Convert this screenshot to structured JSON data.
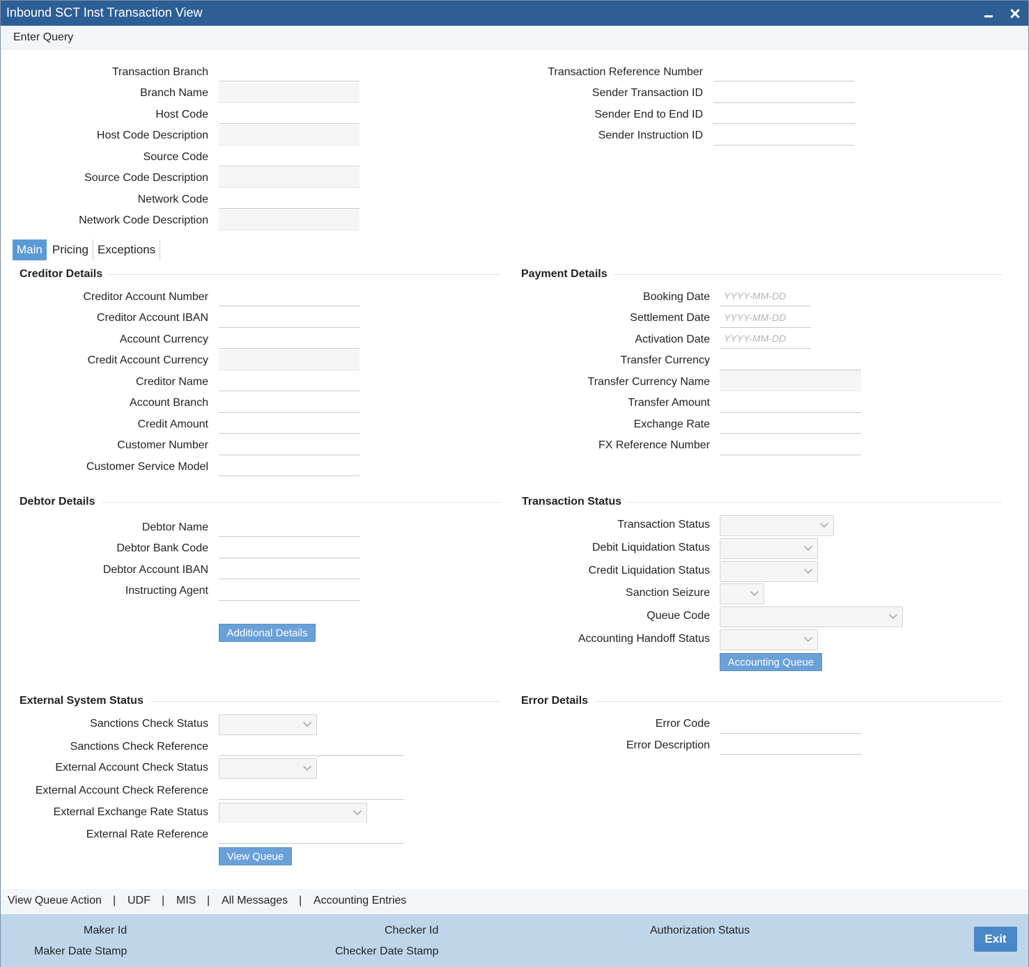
{
  "window": {
    "title": "Inbound SCT Inst Transaction View",
    "minimize_icon": "minimize-icon",
    "close_icon": "close-icon"
  },
  "toolbar": {
    "enter_query": "Enter Query"
  },
  "header": {
    "left": [
      {
        "label": "Transaction Branch",
        "value": ""
      },
      {
        "label": "Branch Name",
        "value": ""
      },
      {
        "label": "Host Code",
        "value": ""
      },
      {
        "label": "Host Code Description",
        "value": ""
      },
      {
        "label": "Source Code",
        "value": ""
      },
      {
        "label": "Source Code Description",
        "value": ""
      },
      {
        "label": "Network Code",
        "value": ""
      },
      {
        "label": "Network Code Description",
        "value": ""
      }
    ],
    "right": [
      {
        "label": "Transaction Reference Number",
        "value": ""
      },
      {
        "label": "Sender Transaction ID",
        "value": ""
      },
      {
        "label": "Sender End to End ID",
        "value": ""
      },
      {
        "label": "Sender Instruction ID",
        "value": ""
      }
    ]
  },
  "tabs": [
    {
      "label": "Main",
      "active": true
    },
    {
      "label": "Pricing",
      "active": false
    },
    {
      "label": "Exceptions",
      "active": false
    }
  ],
  "creditor": {
    "title": "Creditor Details",
    "fields": [
      {
        "label": "Creditor Account Number",
        "value": ""
      },
      {
        "label": "Creditor Account IBAN",
        "value": ""
      },
      {
        "label": "Account Currency",
        "value": ""
      },
      {
        "label": "Credit Account Currency",
        "value": ""
      },
      {
        "label": "Creditor Name",
        "value": ""
      },
      {
        "label": "Account Branch",
        "value": ""
      },
      {
        "label": "Credit Amount",
        "value": ""
      },
      {
        "label": "Customer Number",
        "value": ""
      },
      {
        "label": "Customer Service Model",
        "value": ""
      }
    ]
  },
  "payment": {
    "title": "Payment Details",
    "fields": [
      {
        "label": "Booking Date",
        "value": "",
        "placeholder": "YYYY-MM-DD"
      },
      {
        "label": "Settlement Date",
        "value": "",
        "placeholder": "YYYY-MM-DD"
      },
      {
        "label": "Activation Date",
        "value": "",
        "placeholder": "YYYY-MM-DD"
      },
      {
        "label": "Transfer Currency",
        "value": ""
      },
      {
        "label": "Transfer Currency Name",
        "value": ""
      },
      {
        "label": "Transfer Amount",
        "value": ""
      },
      {
        "label": "Exchange Rate",
        "value": ""
      },
      {
        "label": "FX Reference Number",
        "value": ""
      }
    ]
  },
  "debtor": {
    "title": "Debtor Details",
    "fields": [
      {
        "label": "Debtor Name",
        "value": ""
      },
      {
        "label": "Debtor Bank Code",
        "value": ""
      },
      {
        "label": "Debtor Account IBAN",
        "value": ""
      },
      {
        "label": "Instructing Agent",
        "value": ""
      }
    ],
    "additional_details_button": "Additional Details"
  },
  "txn_status": {
    "title": "Transaction Status",
    "fields": [
      {
        "label": "Transaction Status",
        "value": ""
      },
      {
        "label": "Debit Liquidation Status",
        "value": ""
      },
      {
        "label": "Credit Liquidation Status",
        "value": ""
      },
      {
        "label": "Sanction Seizure",
        "value": ""
      },
      {
        "label": "Queue Code",
        "value": ""
      },
      {
        "label": "Accounting Handoff Status",
        "value": ""
      }
    ],
    "accounting_queue_button": "Accounting Queue"
  },
  "external": {
    "title": "External System Status",
    "fields": [
      {
        "label": "Sanctions Check Status",
        "value": ""
      },
      {
        "label": "Sanctions Check Reference",
        "value": ""
      },
      {
        "label": "External Account Check Status",
        "value": ""
      },
      {
        "label": "External Account Check Reference",
        "value": ""
      },
      {
        "label": "External Exchange Rate Status",
        "value": ""
      },
      {
        "label": "External Rate Reference",
        "value": ""
      }
    ],
    "view_queue_button": "View Queue"
  },
  "error": {
    "title": "Error Details",
    "fields": [
      {
        "label": "Error Code",
        "value": ""
      },
      {
        "label": "Error Description",
        "value": ""
      }
    ]
  },
  "footer_links": [
    "View Queue Action",
    "UDF",
    "MIS",
    "All Messages",
    "Accounting Entries"
  ],
  "footer": {
    "maker_id": "Maker Id",
    "maker_date_stamp": "Maker Date Stamp",
    "checker_id": "Checker Id",
    "checker_date_stamp": "Checker Date Stamp",
    "authorization_status": "Authorization Status",
    "exit": "Exit"
  }
}
